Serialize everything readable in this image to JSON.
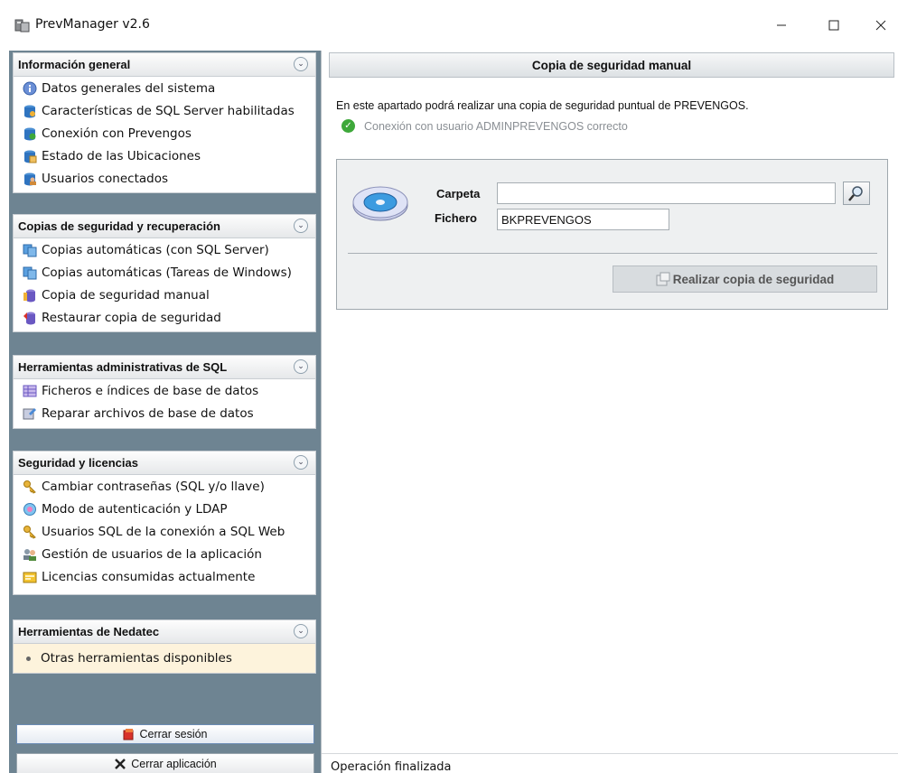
{
  "window": {
    "title": "PrevManager v2.6",
    "minimize_icon": "minimize-icon",
    "maximize_icon": "maximize-icon",
    "close_icon": "close-icon"
  },
  "sidebar": {
    "groups": [
      {
        "title": "Información general",
        "items": [
          {
            "label": "Datos generales del sistema",
            "icon": "info-icon"
          },
          {
            "label": "Características de SQL Server habilitadas",
            "icon": "database-icon"
          },
          {
            "label": "Conexión con Prevengos",
            "icon": "connection-icon"
          },
          {
            "label": "Estado de las Ubicaciones",
            "icon": "location-icon"
          },
          {
            "label": "Usuarios conectados",
            "icon": "users-icon"
          }
        ]
      },
      {
        "title": "Copias de seguridad y recuperación",
        "items": [
          {
            "label": "Copias automáticas (con SQL Server)",
            "icon": "copy-icon"
          },
          {
            "label": "Copias automáticas (Tareas de Windows)",
            "icon": "copy-icon"
          },
          {
            "label": "Copia de seguridad manual",
            "icon": "backup-icon"
          },
          {
            "label": "Restaurar copia de seguridad",
            "icon": "restore-icon"
          }
        ]
      },
      {
        "title": "Herramientas administrativas de SQL",
        "items": [
          {
            "label": "Ficheros e índices de base de datos",
            "icon": "table-icon"
          },
          {
            "label": "Reparar archivos de base de datos",
            "icon": "repair-icon"
          }
        ]
      },
      {
        "title": "Seguridad y licencias",
        "items": [
          {
            "label": "Cambiar contraseñas (SQL y/o llave)",
            "icon": "key-icon"
          },
          {
            "label": "Modo de autenticación y LDAP",
            "icon": "auth-icon"
          },
          {
            "label": "Usuarios SQL de la conexión a SQL Web",
            "icon": "key-icon"
          },
          {
            "label": "Gestión de usuarios de la aplicación",
            "icon": "user-management-icon"
          },
          {
            "label": "Licencias consumidas actualmente",
            "icon": "license-icon"
          }
        ]
      },
      {
        "title": "Herramientas de Nedatec",
        "items": [
          {
            "label": "Otras herramientas disponibles",
            "icon": "bullet-icon"
          }
        ]
      }
    ],
    "logout_label": "Cerrar sesión",
    "exit_label": "Cerrar aplicación"
  },
  "main": {
    "header": "Copia de seguridad manual",
    "intro": "En este apartado podrá realizar una copia de seguridad puntual de PREVENGOS.",
    "connection_status": "Conexión con usuario ADMINPREVENGOS correcto",
    "form": {
      "folder_label": "Carpeta",
      "folder_value": "",
      "file_label": "Fichero",
      "file_value": "BKPREVENGOS",
      "backup_button": "Realizar copia de seguridad"
    }
  },
  "statusbar": {
    "text": "Operación finalizada"
  },
  "colors": {
    "sidebar_bg": "#6e8492",
    "highlight_item_bg": "#fdf3dc",
    "status_ok": "#3ea83a"
  }
}
